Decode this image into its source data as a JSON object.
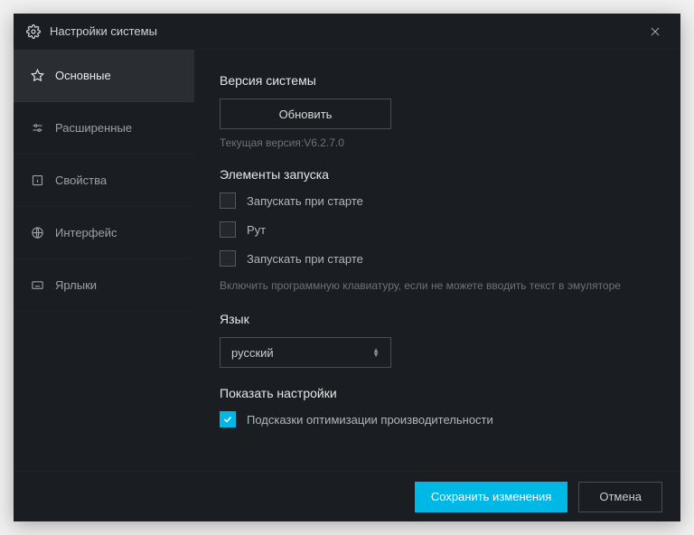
{
  "titlebar": {
    "title": "Настройки системы"
  },
  "sidebar": {
    "items": [
      {
        "label": "Основные"
      },
      {
        "label": "Расширенные"
      },
      {
        "label": "Свойства"
      },
      {
        "label": "Интерфейс"
      },
      {
        "label": "Ярлыки"
      }
    ]
  },
  "content": {
    "version_section_title": "Версия системы",
    "update_button": "Обновить",
    "current_version": "Текущая версия:V6.2.7.0",
    "startup_section_title": "Элементы запуска",
    "cb_start1": "Запускать при старте",
    "cb_root": "Рут",
    "cb_start2": "Запускать при старте",
    "keyboard_hint": "Включить программную клавиатуру, если не можете вводить текст в эмуляторе",
    "language_section_title": "Язык",
    "language_value": "русский",
    "show_settings_title": "Показать настройки",
    "cb_perf_hints": "Подсказки оптимизации производительности"
  },
  "footer": {
    "save": "Сохранить изменения",
    "cancel": "Отмена"
  }
}
